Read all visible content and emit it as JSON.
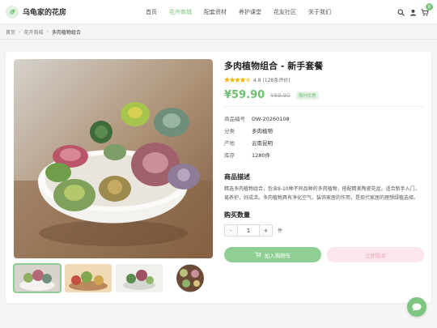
{
  "brand": {
    "name": "乌龟家的花房",
    "icon": "leaf-icon"
  },
  "nav": {
    "items": [
      {
        "label": "首页",
        "active": false
      },
      {
        "label": "花卉商城",
        "active": true
      },
      {
        "label": "配套资材",
        "active": false
      },
      {
        "label": "养护课堂",
        "active": false
      },
      {
        "label": "花友社区",
        "active": false
      },
      {
        "label": "关于我们",
        "active": false
      }
    ]
  },
  "header_tools": {
    "icons": [
      "search-icon",
      "user-icon",
      "cart-icon"
    ],
    "cart_count": "0"
  },
  "breadcrumb": [
    "首页",
    "花卉商城",
    "多肉植物组合"
  ],
  "product": {
    "title": "多肉植物组合 - 新手套餐",
    "rating_value": 4.8,
    "rating_text": "4.8 (128条评价)",
    "price": "¥59.90",
    "old_price": "¥89.90",
    "promo": "限时优惠",
    "specs": [
      {
        "key": "商品编号",
        "value": "DW-20260108"
      },
      {
        "key": "分类",
        "value": "多肉植物"
      },
      {
        "key": "产地",
        "value": "云南昆明"
      },
      {
        "key": "库存",
        "value": "1280件"
      }
    ],
    "desc_title": "商品描述",
    "description": "精选多肉植物组合，包含8-10种不同品种的多肉植物，搭配精美陶瓷花盆。适合新手入门，易养护，好成活。多肉植物具有净化空气、装饰家居的作用，是现代家居的理想绿植选择。",
    "qty_title": "购买数量",
    "qty": "1",
    "qty_minus": "-",
    "qty_plus": "+",
    "unit": "件",
    "add_cart_label": "加入购物车",
    "buy_now_label": "立即购买"
  },
  "gallery": {
    "thumb_count": 4,
    "selected_index": 0
  },
  "colors": {
    "accent": "#7bc47f",
    "buy_bg": "#fbe6ec",
    "buy_text": "#e8a7b8",
    "star": "#f5b301"
  }
}
